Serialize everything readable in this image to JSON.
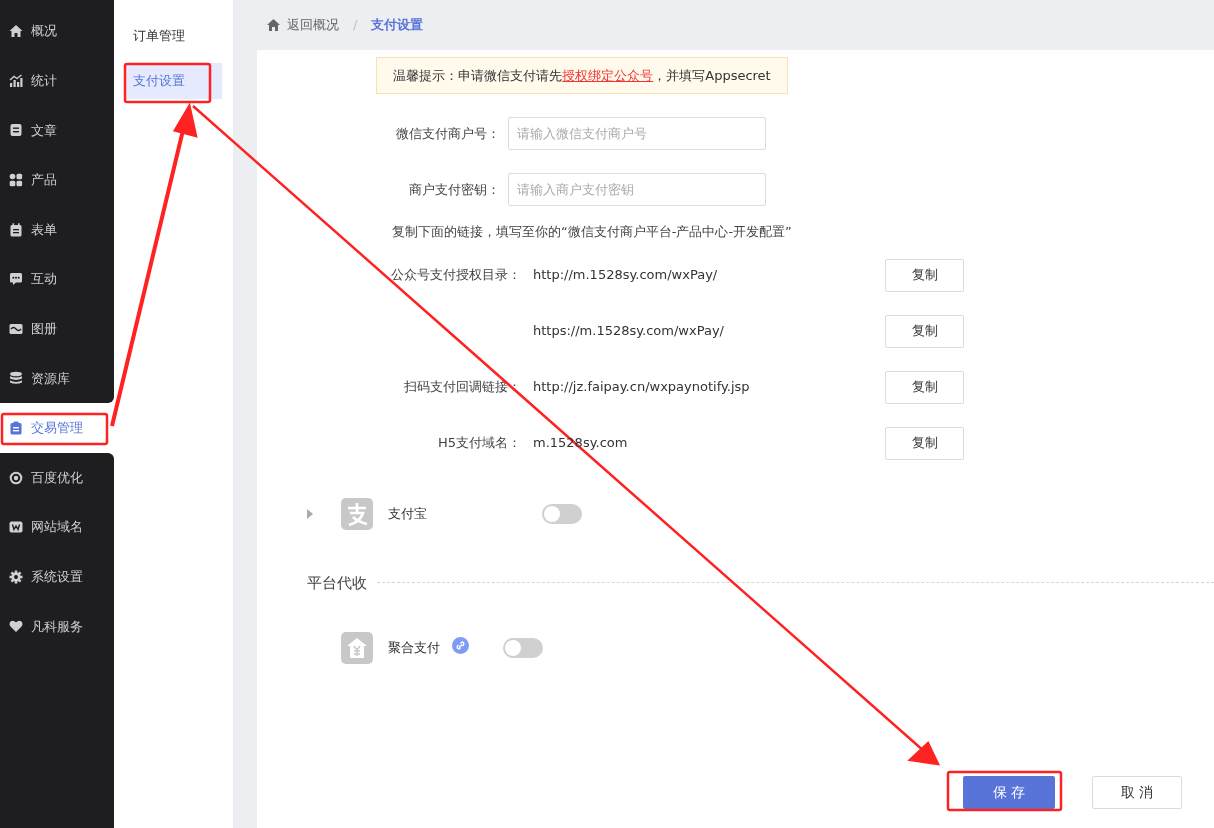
{
  "sidebar": {
    "items": [
      {
        "label": "概况",
        "selected": false
      },
      {
        "label": "统计",
        "selected": false
      },
      {
        "label": "文章",
        "selected": false
      },
      {
        "label": "产品",
        "selected": false
      },
      {
        "label": "表单",
        "selected": false
      },
      {
        "label": "互动",
        "selected": false
      },
      {
        "label": "图册",
        "selected": false
      },
      {
        "label": "资源库",
        "selected": false
      },
      {
        "label": "交易管理",
        "selected": true
      },
      {
        "label": "百度优化",
        "selected": false
      },
      {
        "label": "网站域名",
        "selected": false
      },
      {
        "label": "系统设置",
        "selected": false
      },
      {
        "label": "凡科服务",
        "selected": false
      }
    ]
  },
  "subnav": {
    "items": [
      {
        "label": "订单管理",
        "selected": false
      },
      {
        "label": "支付设置",
        "selected": true
      }
    ]
  },
  "breadcrumb": {
    "back": "返回概况",
    "separator": "/",
    "current": "支付设置"
  },
  "notice": {
    "text": "温馨提示：申请微信支付请先",
    "link": "授权绑定公众号",
    "suffix": "，并填写Appsecret"
  },
  "fields": [
    {
      "label": "微信支付商户号：",
      "placeholder": "请输入微信支付商户号"
    },
    {
      "label": "商户支付密钥：",
      "placeholder": "请输入商户支付密钥"
    }
  ],
  "instruction": "复制下面的链接，填写至你的“微信支付商户平台-产品中心-开发配置”",
  "links": [
    {
      "label": "公众号支付授权目录：",
      "url": "http://m.1528sy.com/wxPay/",
      "button": "复制"
    },
    {
      "url": "https://m.1528sy.com/wxPay/",
      "button": "复制"
    },
    {
      "label": "扫码支付回调链接：",
      "url": "http://jz.faipay.cn/wxpaynotify.jsp",
      "button": "复制"
    },
    {
      "label": "H5支付域名：",
      "url": "m.1528sy.com",
      "button": "复制"
    }
  ],
  "providers": [
    {
      "kind": "alipay",
      "name": "支付宝",
      "on": false,
      "expanded": false
    }
  ],
  "platform_section": {
    "title": "平台代收",
    "providers": [
      {
        "kind": "aggregate",
        "name": "聚合支付",
        "on": false
      }
    ]
  },
  "actions": {
    "save": "保 存",
    "cancel": "取 消"
  }
}
